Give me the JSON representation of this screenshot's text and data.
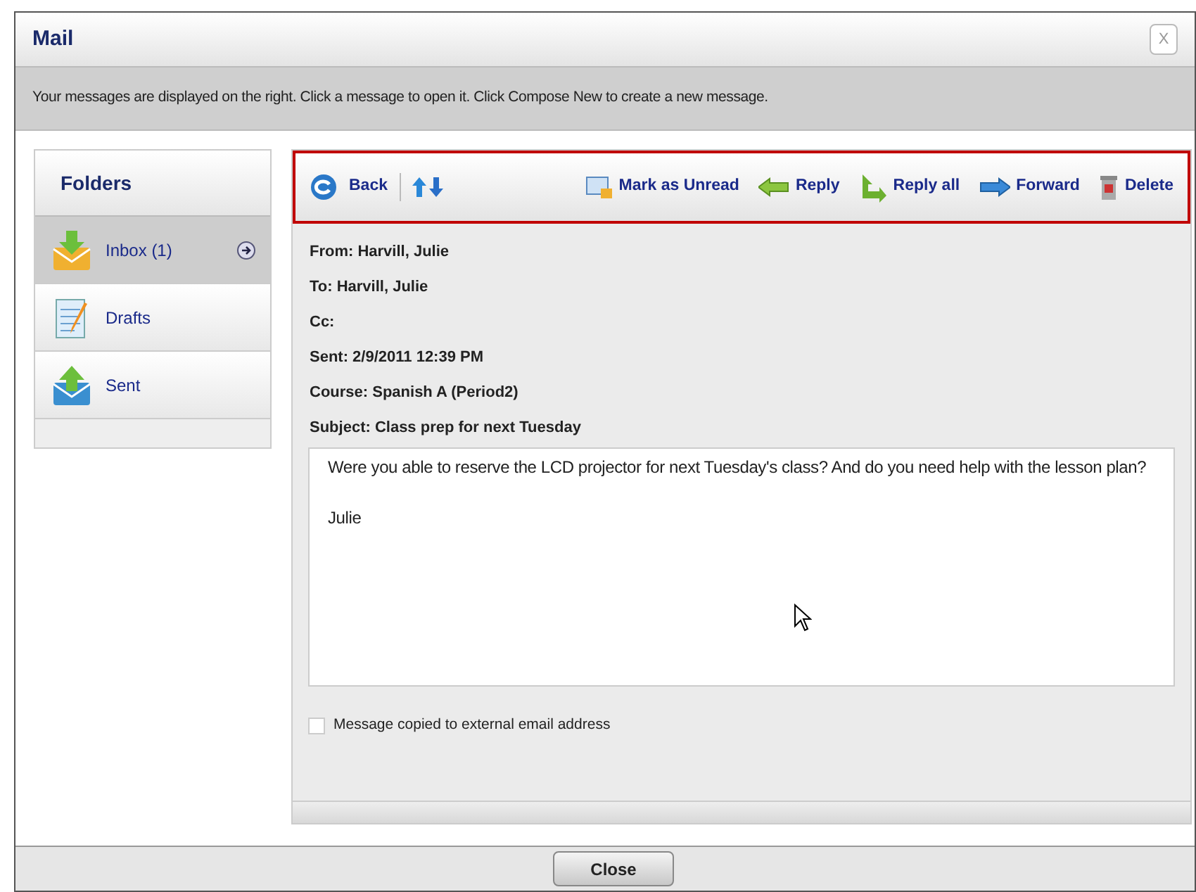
{
  "window": {
    "title": "Mail",
    "close_label": "X"
  },
  "info_bar": "Your messages are displayed on the right. Click a message to open it. Click Compose New to create a new message.",
  "folders": {
    "title": "Folders",
    "items": [
      {
        "kind": "inbox",
        "label": "Inbox (1)",
        "selected": true
      },
      {
        "kind": "drafts",
        "label": "Drafts",
        "selected": false
      },
      {
        "kind": "sent",
        "label": "Sent",
        "selected": false
      }
    ]
  },
  "toolbar": {
    "highlighted": true,
    "left": [
      {
        "kind": "back",
        "label": "Back"
      },
      {
        "kind": "updown"
      }
    ],
    "right": [
      {
        "kind": "unread",
        "label": "Mark as Unread"
      },
      {
        "kind": "reply",
        "label": "Reply"
      },
      {
        "kind": "replyall",
        "label": "Reply all"
      },
      {
        "kind": "forward",
        "label": "Forward"
      },
      {
        "kind": "delete",
        "label": "Delete"
      }
    ]
  },
  "headers": [
    "From: Harvill, Julie",
    "To: Harvill, Julie",
    "Cc:",
    "Sent: 2/9/2011 12:39 PM",
    "Course: Spanish A (Period2)",
    "Subject: Class prep for next Tuesday"
  ],
  "body": [
    "Were you able to reserve the LCD projector for next Tuesday's class? And do you need help with the lesson plan?",
    "Julie"
  ],
  "external_copy": {
    "label": "Message copied to external email address",
    "checked": false
  },
  "footer": {
    "button": "Close"
  }
}
